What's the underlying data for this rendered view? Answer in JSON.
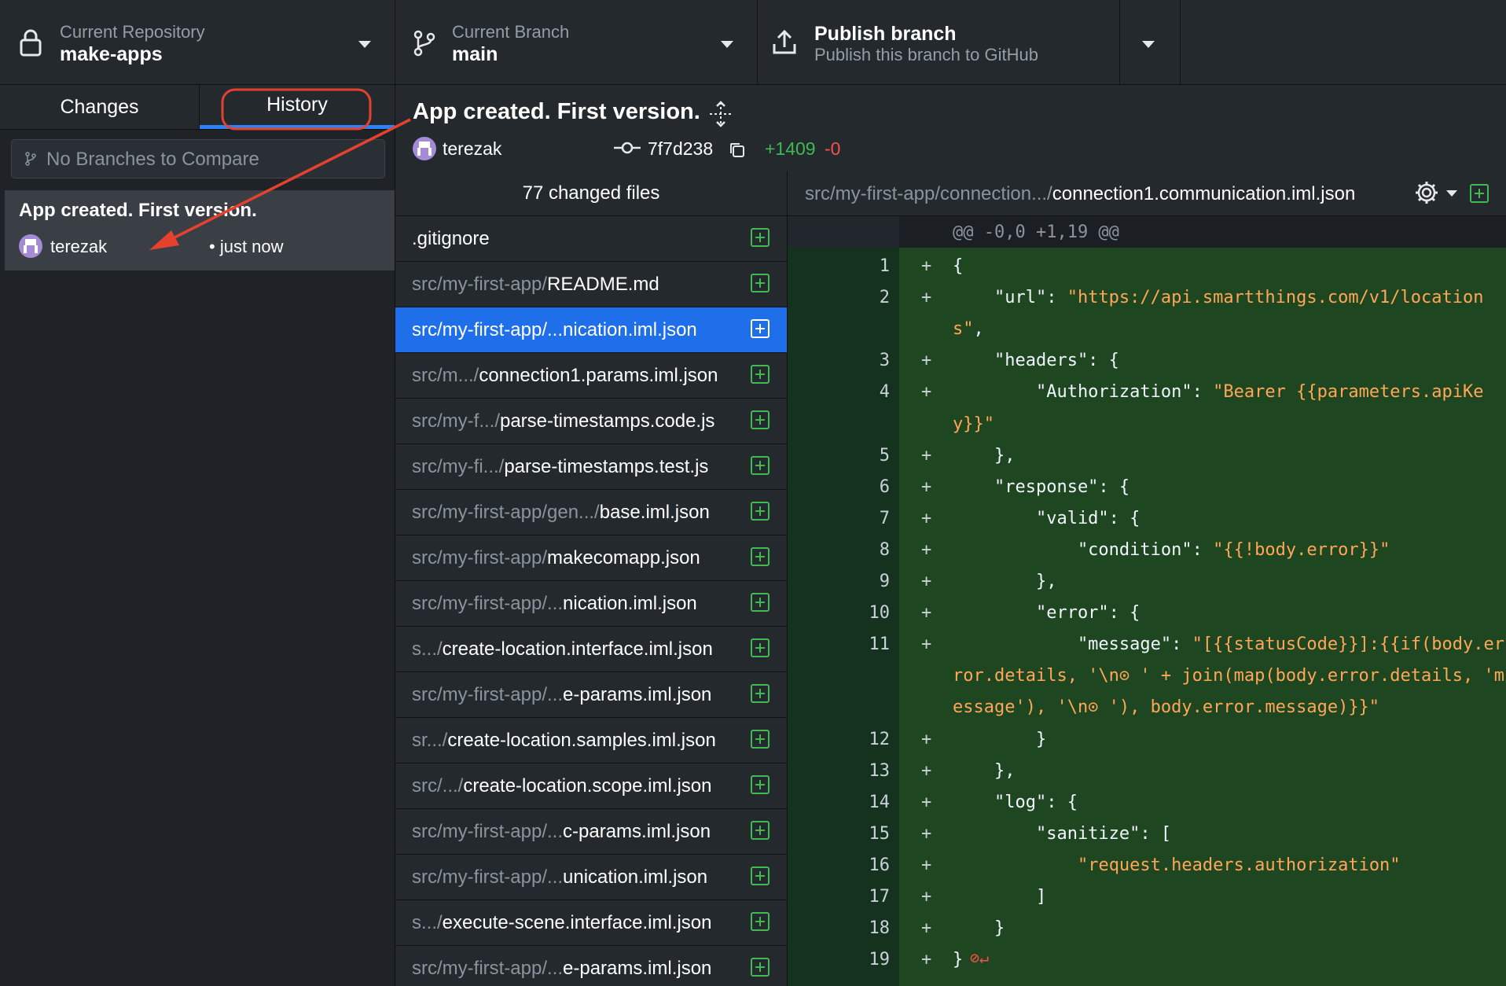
{
  "toolbar": {
    "repository": {
      "label": "Current Repository",
      "value": "make-apps"
    },
    "branch": {
      "label": "Current Branch",
      "value": "main"
    },
    "publish": {
      "title": "Publish branch",
      "subtitle": "Publish this branch to GitHub"
    }
  },
  "tabs": {
    "changes": "Changes",
    "history": "History"
  },
  "compare": {
    "placeholder": "No Branches to Compare"
  },
  "history_commit": {
    "title": "App created. First version.",
    "author": "terezak",
    "time": "• just now"
  },
  "commit_header": {
    "title": "App created. First version.",
    "author": "terezak",
    "sha": "7f7d238",
    "additions": "+1409",
    "deletions": "-0"
  },
  "file_list": {
    "header": "77 changed files",
    "files": [
      {
        "dim": "",
        "name": ".gitignore"
      },
      {
        "dim": "src/my-first-app/",
        "name": "README.md"
      },
      {
        "dim": "src/my-first-app/...",
        "name": "nication.iml.json"
      },
      {
        "dim": "src/m.../",
        "name": "connection1.params.iml.json"
      },
      {
        "dim": "src/my-f.../",
        "name": "parse-timestamps.code.js"
      },
      {
        "dim": "src/my-fi.../",
        "name": "parse-timestamps.test.js"
      },
      {
        "dim": "src/my-first-app/gen.../",
        "name": "base.iml.json"
      },
      {
        "dim": "src/my-first-app/",
        "name": "makecomapp.json"
      },
      {
        "dim": "src/my-first-app/...",
        "name": "nication.iml.json"
      },
      {
        "dim": "s.../",
        "name": "create-location.interface.iml.json"
      },
      {
        "dim": "src/my-first-app/...",
        "name": "e-params.iml.json"
      },
      {
        "dim": "sr.../",
        "name": "create-location.samples.iml.json"
      },
      {
        "dim": "src/.../",
        "name": "create-location.scope.iml.json"
      },
      {
        "dim": "src/my-first-app/...",
        "name": "c-params.iml.json"
      },
      {
        "dim": "src/my-first-app/...",
        "name": "unication.iml.json"
      },
      {
        "dim": "s.../",
        "name": "execute-scene.interface.iml.json"
      },
      {
        "dim": "src/my-first-app/...",
        "name": "e-params.iml.json"
      }
    ]
  },
  "diff": {
    "path_dim": "src/my-first-app/connection.../",
    "path_name": "connection1.communication.iml.json",
    "hunk": "@@ -0,0 +1,19 @@",
    "lines": [
      {
        "n": "1",
        "plus": "+",
        "segs": [
          {
            "t": "{",
            "s": false
          }
        ]
      },
      {
        "n": "2",
        "plus": "+",
        "segs": [
          {
            "t": "    \"url\": ",
            "s": false
          },
          {
            "t": "\"https://api.smartthings.com/v1/location",
            "s": true
          }
        ]
      },
      {
        "n": "",
        "plus": "",
        "segs": [
          {
            "t": "s\"",
            "s": true
          },
          {
            "t": ",",
            "s": false
          }
        ]
      },
      {
        "n": "3",
        "plus": "+",
        "segs": [
          {
            "t": "    \"headers\": {",
            "s": false
          }
        ]
      },
      {
        "n": "4",
        "plus": "+",
        "segs": [
          {
            "t": "        \"Authorization\": ",
            "s": false
          },
          {
            "t": "\"Bearer {{parameters.apiKe",
            "s": true
          }
        ]
      },
      {
        "n": "",
        "plus": "",
        "segs": [
          {
            "t": "y}}\"",
            "s": true
          }
        ]
      },
      {
        "n": "5",
        "plus": "+",
        "segs": [
          {
            "t": "    },",
            "s": false
          }
        ]
      },
      {
        "n": "6",
        "plus": "+",
        "segs": [
          {
            "t": "    \"response\": {",
            "s": false
          }
        ]
      },
      {
        "n": "7",
        "plus": "+",
        "segs": [
          {
            "t": "        \"valid\": {",
            "s": false
          }
        ]
      },
      {
        "n": "8",
        "plus": "+",
        "segs": [
          {
            "t": "            \"condition\": ",
            "s": false
          },
          {
            "t": "\"{{!body.error}}\"",
            "s": true
          }
        ]
      },
      {
        "n": "9",
        "plus": "+",
        "segs": [
          {
            "t": "        },",
            "s": false
          }
        ]
      },
      {
        "n": "10",
        "plus": "+",
        "segs": [
          {
            "t": "        \"error\": {",
            "s": false
          }
        ]
      },
      {
        "n": "11",
        "plus": "+",
        "segs": [
          {
            "t": "            \"message\": ",
            "s": false
          },
          {
            "t": "\"[{{statusCode}}]:{{if(body.er",
            "s": true
          }
        ]
      },
      {
        "n": "",
        "plus": "",
        "segs": [
          {
            "t": "ror.details, '\\n⊙ ' + join(map(body.error.details, 'm",
            "s": true
          }
        ]
      },
      {
        "n": "",
        "plus": "",
        "segs": [
          {
            "t": "essage'), '\\n⊙ '), body.error.message)}}\"",
            "s": true
          }
        ]
      },
      {
        "n": "12",
        "plus": "+",
        "segs": [
          {
            "t": "        }",
            "s": false
          }
        ]
      },
      {
        "n": "13",
        "plus": "+",
        "segs": [
          {
            "t": "    },",
            "s": false
          }
        ]
      },
      {
        "n": "14",
        "plus": "+",
        "segs": [
          {
            "t": "    \"log\": {",
            "s": false
          }
        ]
      },
      {
        "n": "15",
        "plus": "+",
        "segs": [
          {
            "t": "        \"sanitize\": [",
            "s": false
          }
        ]
      },
      {
        "n": "16",
        "plus": "+",
        "segs": [
          {
            "t": "            ",
            "s": false
          },
          {
            "t": "\"request.headers.authorization\"",
            "s": true
          }
        ]
      },
      {
        "n": "17",
        "plus": "+",
        "segs": [
          {
            "t": "        ]",
            "s": false
          }
        ]
      },
      {
        "n": "18",
        "plus": "+",
        "segs": [
          {
            "t": "    }",
            "s": false
          }
        ]
      },
      {
        "n": "19",
        "plus": "+",
        "segs": [
          {
            "t": "}",
            "s": false
          }
        ]
      }
    ]
  },
  "colors": {
    "accent": "#1f6feb",
    "added": "#3fb950",
    "deleted": "#f85149",
    "annotation": "#e5412d"
  }
}
